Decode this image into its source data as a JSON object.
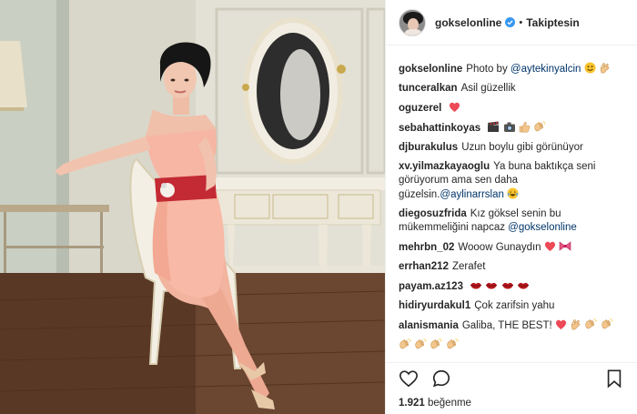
{
  "post": {
    "username": "gokselonline",
    "follow_status": "Takiptesin",
    "separator": "•",
    "likes_count": "1.921",
    "likes_word": "beğenme"
  },
  "comments": [
    {
      "user": "gokselonline",
      "text": "Photo by ",
      "mention": "@aytekinyalcin",
      "after": "",
      "emojis": [
        "smile-emoji",
        "ok-hand-emoji"
      ]
    },
    {
      "user": "tunceralkan",
      "text": "Asil güzellik",
      "mention": "",
      "after": "",
      "emojis": []
    },
    {
      "user": "oguzerel",
      "text": "",
      "mention": "",
      "after": "",
      "emojis": [
        "red-heart-emoji"
      ]
    },
    {
      "user": "sebahattinkoyas",
      "text": "",
      "mention": "",
      "after": "",
      "emojis": [
        "clapper-emoji",
        "camera-emoji",
        "thumbs-up-emoji",
        "clap-emoji"
      ]
    },
    {
      "user": "djburakulus",
      "text": "Uzun boylu gibi görünüyor",
      "mention": "",
      "after": "",
      "emojis": []
    },
    {
      "user": "xv.yilmazkayaoglu",
      "text": "Ya buna baktıkça seni görüyorum ama sen daha güzelsin.",
      "mention": "@aylinarrslan",
      "after": "",
      "emojis": [
        "laugh-cry-emoji"
      ]
    },
    {
      "user": "diegosuzfrida",
      "text": "Kız göksel senin bu mükemmeliğini napcaz ",
      "mention": "@gokselonline",
      "after": "",
      "emojis": []
    },
    {
      "user": "mehrbn_02",
      "text": "Wooow Gunaydın",
      "mention": "",
      "after": "",
      "emojis": [
        "red-heart-emoji",
        "bow-emoji"
      ]
    },
    {
      "user": "errhan212",
      "text": "Zerafet",
      "mention": "",
      "after": "",
      "emojis": []
    },
    {
      "user": "payam.az123",
      "text": "",
      "mention": "",
      "after": "",
      "emojis": [
        "lips-emoji",
        "lips-emoji",
        "lips-emoji",
        "lips-emoji"
      ]
    },
    {
      "user": "hidiryurdakul1",
      "text": "Çok zarifsin yahu",
      "mention": "",
      "after": "",
      "emojis": []
    },
    {
      "user": "alanismania",
      "text": "Galiba, THE BEST!",
      "mention": "",
      "after": "",
      "emojis": [
        "red-heart-emoji",
        "ok-hand-emoji",
        "clap-emoji",
        "clap-emoji"
      ]
    },
    {
      "user": "",
      "text": "",
      "mention": "",
      "after": "",
      "emojis": [
        "clap-emoji",
        "clap-emoji",
        "clap-emoji",
        "clap-emoji"
      ]
    }
  ],
  "icons": {
    "like": "heart-outline-icon",
    "comment": "comment-bubble-icon",
    "save": "bookmark-icon",
    "verified": "verified-badge-icon"
  },
  "colors": {
    "verified": "#3897f0",
    "mention": "#003569",
    "heart": "#ed4956"
  }
}
